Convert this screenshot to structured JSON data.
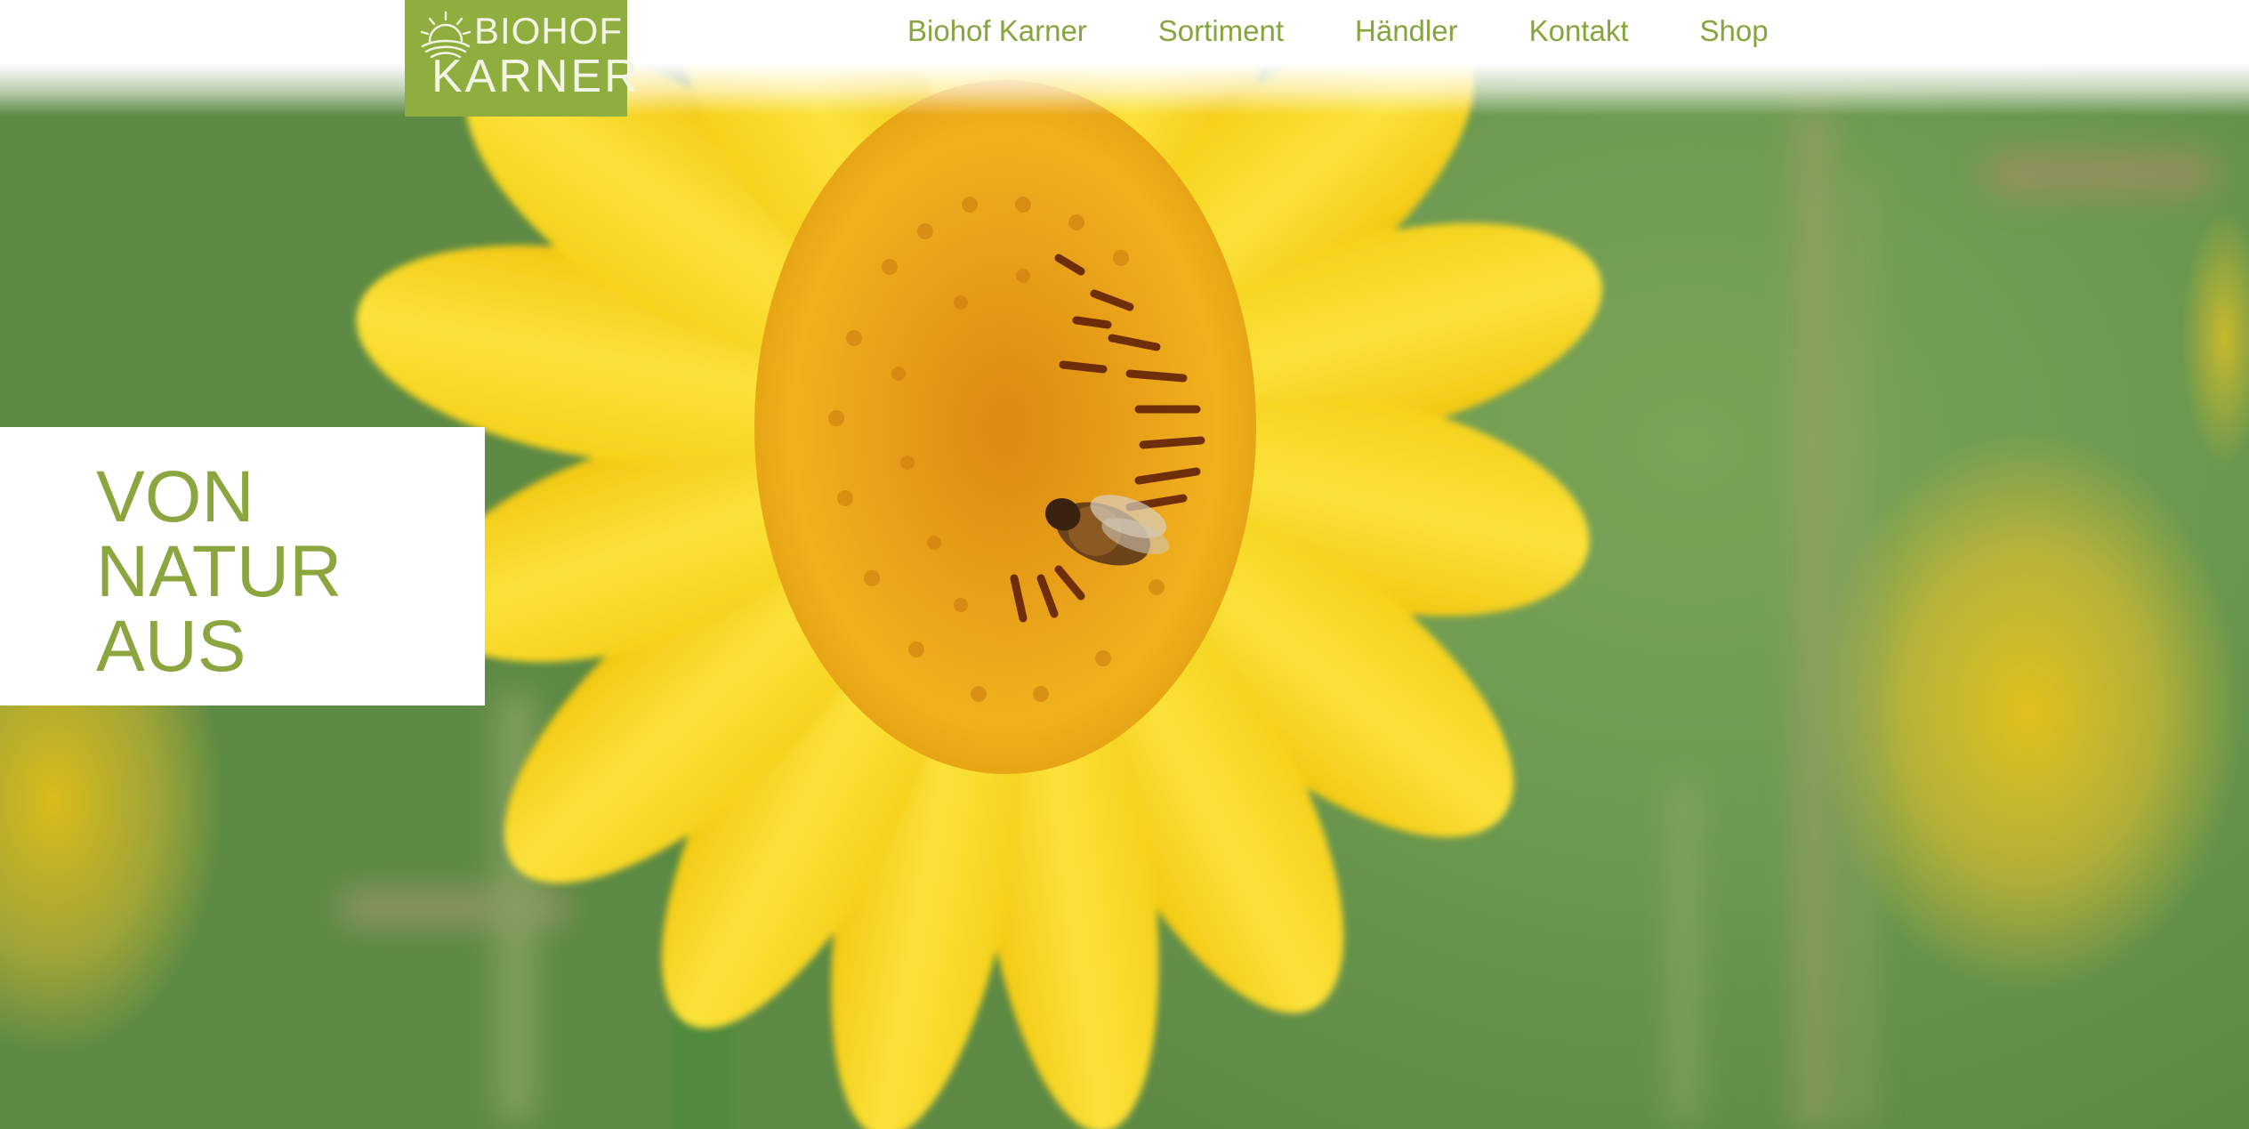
{
  "brand": {
    "logo_line_1": "BIOHOF",
    "logo_line_2": "KARNER",
    "logo_color": "#8fae3f"
  },
  "nav": {
    "items": [
      {
        "label": "Biohof Karner"
      },
      {
        "label": "Sortiment"
      },
      {
        "label": "Händler"
      },
      {
        "label": "Kontakt"
      },
      {
        "label": "Shop"
      }
    ],
    "text_color": "#86a53c"
  },
  "hero": {
    "slogan": {
      "line_1": "VON",
      "line_2": "NATUR",
      "line_3": "AUS"
    },
    "slogan_color": "#8ba63e"
  },
  "icons": {
    "logo_symbol": "sun-icon"
  }
}
